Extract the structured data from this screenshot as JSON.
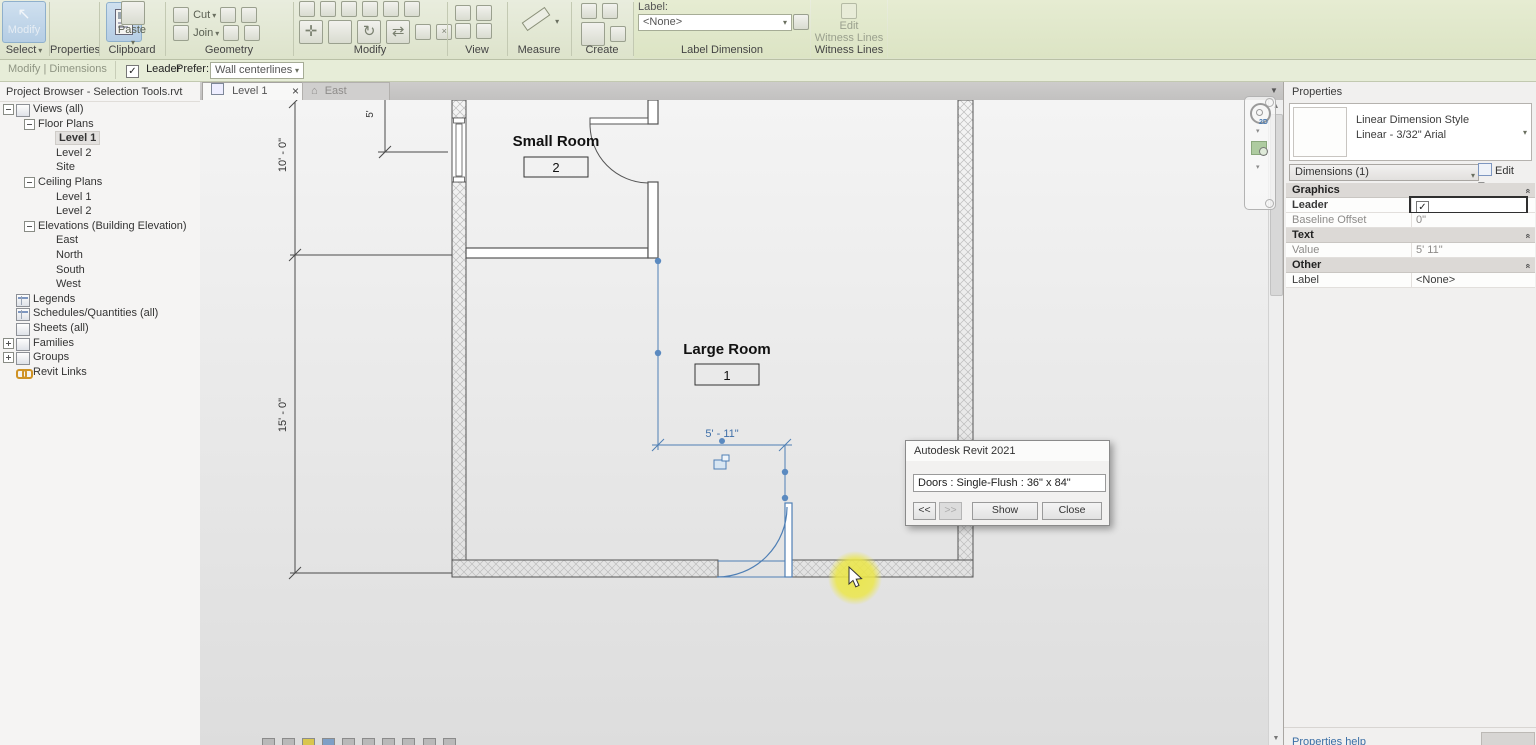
{
  "icons": {
    "check": "✓",
    "dropdown": "▾",
    "close": "×",
    "home": "⌂",
    "up": "▲",
    "down": "▼",
    "cursor": "↖",
    "collapse": "«",
    "move": "✛",
    "rotate": "↻",
    "arrows": "⇄"
  },
  "ribbon": {
    "select_button": "Modify",
    "select_label": "Select",
    "properties_label": "Properties",
    "paste_label": "Paste",
    "clipboard_label": "Clipboard",
    "cut_label": "Cut",
    "join_label": "Join",
    "geometry_label": "Geometry",
    "modify_label": "Modify",
    "view_label": "View",
    "measure_label": "Measure",
    "create_label": "Create",
    "label_field": "Label:",
    "label_value": "<None>",
    "label_dimension_label": "Label Dimension",
    "witness_button_line1": "Edit",
    "witness_button_line2": "Witness Lines",
    "witness_label": "Witness Lines"
  },
  "options_bar": {
    "mode": "Modify | Dimensions",
    "leader": "Leader",
    "prefer": "Prefer:",
    "prefer_value": "Wall centerlines"
  },
  "project_browser": {
    "title": "Project Browser - Selection Tools.rvt",
    "items": [
      "Views (all)",
      "Floor Plans",
      "Level 1",
      "Level 2",
      "Site",
      "Ceiling Plans",
      "Level 1",
      "Level 2",
      "Elevations (Building Elevation)",
      "East",
      "North",
      "South",
      "West",
      "Legends",
      "Schedules/Quantities (all)",
      "Sheets (all)",
      "Families",
      "Groups",
      "Revit Links"
    ]
  },
  "view_tabs": {
    "active": "Level 1",
    "inactive": "East"
  },
  "plan": {
    "room1_name": "Small Room",
    "room1_number": "2",
    "room2_name": "Large Room",
    "room2_number": "1",
    "dim_selected": "5' - 11\"",
    "dim_left_upper": "10' - 0\"",
    "dim_left_lower": "15' - 0\"",
    "dim_top": "5'"
  },
  "dialog": {
    "title": "Autodesk Revit 2021",
    "message": "Doors : Single-Flush : 36\" x 84\"",
    "prev": "<<",
    "next": ">>",
    "show": "Show",
    "close": "Close"
  },
  "properties": {
    "title": "Properties",
    "type_name": "Linear Dimension Style",
    "type_desc": "Linear - 3/32\" Arial",
    "selector": "Dimensions (1)",
    "edit_type": "Edit Type",
    "graphics": "Graphics",
    "leader": "Leader",
    "baseline_offset": "Baseline Offset",
    "baseline_value": "0\"",
    "text": "Text",
    "value": "Value",
    "value_value": "5' 11\"",
    "other": "Other",
    "label": "Label",
    "label_value": "<None>",
    "help": "Properties help"
  },
  "colors": {
    "selection_blue": "#4f7fb5",
    "highlight_yellow": "#eae545",
    "ribbon_green": "#e4ecd2"
  }
}
